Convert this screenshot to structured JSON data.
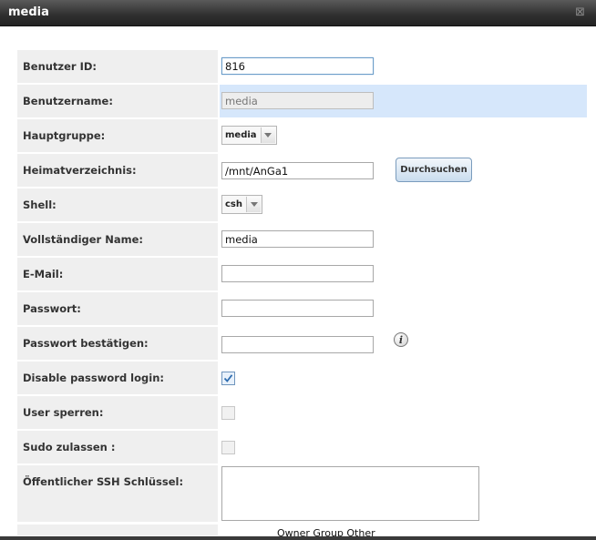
{
  "dialog": {
    "title": "media",
    "close_glyph": "⊠"
  },
  "fields": {
    "user_id": {
      "label": "Benutzer ID:",
      "value": "816"
    },
    "username": {
      "label": "Benutzername:",
      "value": "media"
    },
    "primary_group": {
      "label": "Hauptgruppe:",
      "value": "media"
    },
    "home_dir": {
      "label": "Heimatverzeichnis:",
      "value": "/mnt/AnGa1",
      "browse_label": "Durchsuchen"
    },
    "shell": {
      "label": "Shell:",
      "value": "csh"
    },
    "full_name": {
      "label": "Vollständiger Name:",
      "value": "media"
    },
    "email": {
      "label": "E-Mail:",
      "value": ""
    },
    "password": {
      "label": "Passwort:",
      "value": ""
    },
    "password_confirm": {
      "label": "Passwort bestätigen:",
      "value": "",
      "info_glyph": "i"
    },
    "disable_password_login": {
      "label": "Disable password login:",
      "checked": true
    },
    "lock_user": {
      "label": "User sperren:",
      "checked": false
    },
    "allow_sudo": {
      "label": "Sudo zulassen :",
      "checked": false
    },
    "ssh_key": {
      "label": "Öffentlicher SSH Schlüssel:",
      "value": ""
    }
  },
  "permissions": {
    "header": "Owner Group Other"
  },
  "icons": {
    "close": "close-icon",
    "dropdown": "chevron-down-icon",
    "info": "info-icon",
    "check": "checkmark-icon"
  },
  "colors": {
    "titlebar": "#2f2f2f",
    "label_bg": "#efefef",
    "highlight_row": "#d6e7fb",
    "button": "#c9dcee"
  }
}
